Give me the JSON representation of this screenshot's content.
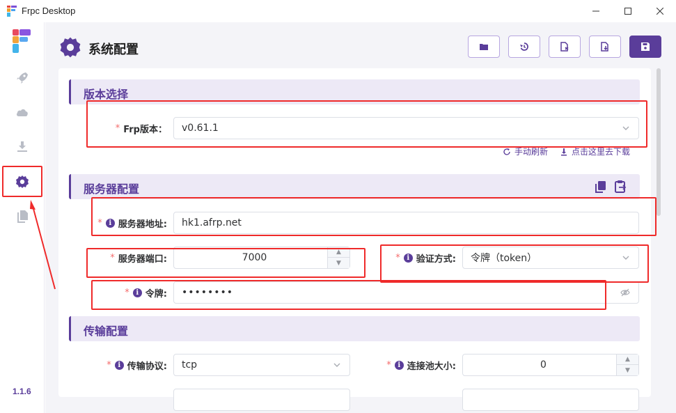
{
  "window": {
    "title": "Frpc Desktop",
    "controls": [
      "minimize",
      "maximize",
      "close"
    ]
  },
  "sidebar": {
    "items": [
      {
        "icon": "rocket-icon"
      },
      {
        "icon": "cloud-icon"
      },
      {
        "icon": "download-icon"
      },
      {
        "icon": "gear-icon",
        "active": true
      },
      {
        "icon": "files-icon"
      }
    ],
    "version": "1.1.6"
  },
  "page": {
    "title": "系统配置"
  },
  "toolbar": {
    "buttons": [
      "folder-icon",
      "history-icon",
      "file-export-icon",
      "file-import-icon",
      "save-icon"
    ]
  },
  "sections": {
    "version": {
      "title": "版本选择",
      "frp_version_label": "Frp版本：",
      "frp_version_value": "v0.61.1",
      "refresh_link": "手动刷新",
      "download_link": "点击这里去下载"
    },
    "server": {
      "title": "服务器配置",
      "address_label": "服务器地址:",
      "address_value": "hk1.afrp.net",
      "port_label": "服务器端口:",
      "port_value": "7000",
      "auth_label": "验证方式:",
      "auth_value": "令牌（token）",
      "token_label": "令牌:",
      "token_value": "••••••••"
    },
    "transport": {
      "title": "传输配置",
      "protocol_label": "传输协议:",
      "protocol_value": "tcp",
      "pool_label": "连接池大小:",
      "pool_value": "0"
    }
  },
  "colors": {
    "accent": "#5a3d9a",
    "section_bg": "#ede9f6",
    "required": "#f56c6c",
    "annotation": "#ef2a2a"
  }
}
